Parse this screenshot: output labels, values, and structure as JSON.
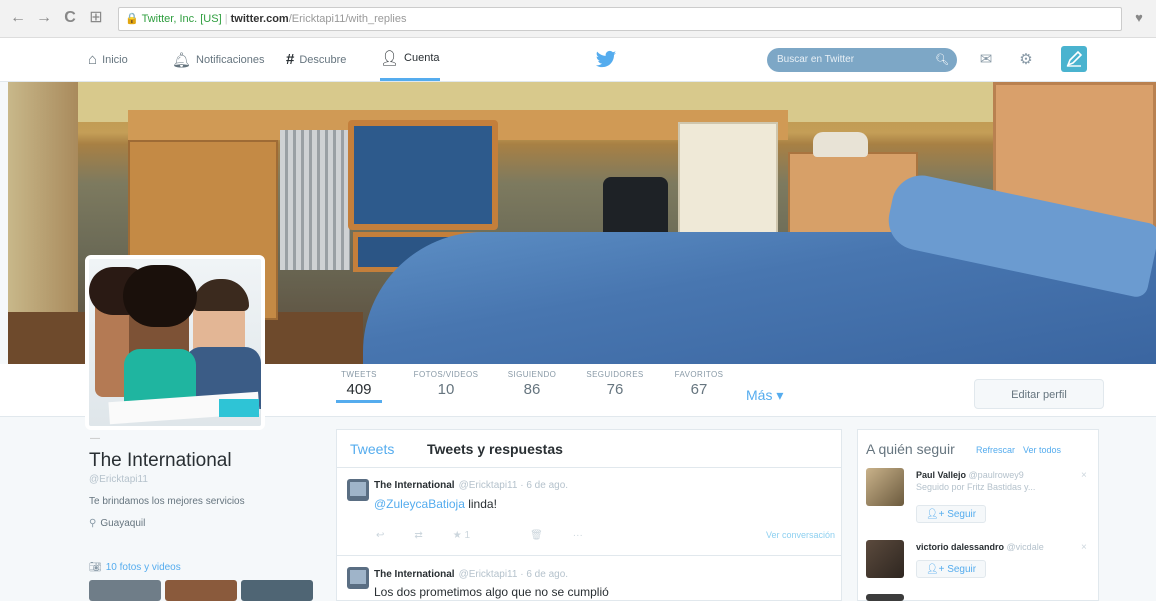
{
  "browser": {
    "back": "←",
    "forward": "→",
    "reload": "C",
    "apps": "⊞",
    "secure_label": "Twitter, Inc. [US]",
    "domain": "twitter.com",
    "path": "/Ericktapi11/with_replies"
  },
  "topnav": {
    "items": [
      {
        "label": "Inicio",
        "icon": "home-icon"
      },
      {
        "label": "Notificaciones",
        "icon": "bell-icon"
      },
      {
        "label": "Descubre",
        "icon": "hashtag-icon"
      },
      {
        "label": "Cuenta",
        "icon": "user-icon"
      }
    ],
    "search_placeholder": "Buscar en Twitter"
  },
  "profile": {
    "name": "The International",
    "handle": "@Ericktapi11",
    "bio": "Te brindamos los mejores servicios",
    "location": "Guayaquil",
    "photos_label": "10 fotos y videos",
    "edit_label": "Editar perfil"
  },
  "stats": [
    {
      "label": "TWEETS",
      "value": "409"
    },
    {
      "label": "FOTOS/VIDEOS",
      "value": "10"
    },
    {
      "label": "SIGUIENDO",
      "value": "86"
    },
    {
      "label": "SEGUIDORES",
      "value": "76"
    },
    {
      "label": "FAVORITOS",
      "value": "67"
    }
  ],
  "more_label": "Más ▾",
  "timeline": {
    "tab_tweets": "Tweets",
    "tab_replies": "Tweets y respuestas",
    "tweets": [
      {
        "author": "The International",
        "meta": "@Ericktapi11 · 6 de ago.",
        "mention": "@ZuleycaBatioja",
        "text": " linda!",
        "fav_count": "1",
        "conversation": "Ver conversación"
      },
      {
        "author": "The International",
        "meta": "@Ericktapi11 · 6 de ago.",
        "text": "Los dos prometimos algo que no se cumplió"
      }
    ]
  },
  "who_to_follow": {
    "title": "A quién seguir",
    "refresh": "Refrescar",
    "view_all": "Ver todos",
    "follow_label": "Seguir",
    "users": [
      {
        "name": "Paul Vallejo",
        "handle": "@paulrowey9",
        "sub": "Seguido por Fritz Bastidas y..."
      },
      {
        "name": "victorio dalessandro",
        "handle": "@vicdale"
      }
    ]
  },
  "colors": {
    "accent": "#55acee",
    "tweet_button": "#4ab3cf",
    "search_bg": "#7da7c6"
  }
}
